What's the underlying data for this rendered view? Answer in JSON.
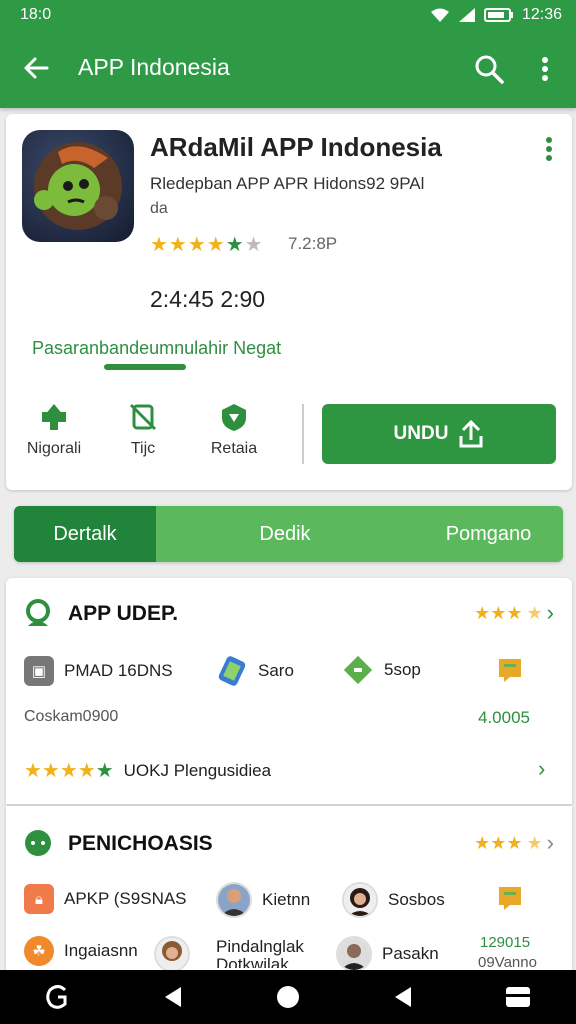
{
  "status_bar": {
    "time_left": "18:0",
    "clock": "12:36"
  },
  "app_bar": {
    "title": "APP Indonesia"
  },
  "app": {
    "name": "ARdaMil APP Indonesia",
    "subtitle": "Rledepban APP APR Hidons92 9PAl",
    "subtitle2": "da",
    "rating_count": "7.2:8P",
    "size": "2:4:45 2:90",
    "link": "Pasaranbandeumnulahir Negat",
    "rating": 3.5
  },
  "actions": [
    {
      "label": "Nigorali",
      "icon": "tree-icon"
    },
    {
      "label": "Tijc",
      "icon": "crossed-device-icon"
    },
    {
      "label": "Retaia",
      "icon": "shield-icon"
    }
  ],
  "download_label": "UNDU",
  "tabs": [
    {
      "label": "Dertalk",
      "active": true
    },
    {
      "label": "Dedik"
    },
    {
      "label": "Pomgano"
    }
  ],
  "section1": {
    "title": "APP UDEP.",
    "items": [
      {
        "label": "PMAD 16DNS",
        "color": "#777777"
      },
      {
        "label": "Saro",
        "color": "#3a7bd5"
      },
      {
        "label": "5sop",
        "color": "#5bb04c"
      }
    ],
    "caption": "Coskam0900",
    "count": "4.0005",
    "review": "UOKJ Plengusidiea"
  },
  "section2": {
    "title": "PENICHOASIS",
    "items": [
      {
        "label": "APKP (S9SNAS",
        "color": "#f07a4a"
      },
      {
        "label": "Kietnn"
      },
      {
        "label": "Sosbos"
      }
    ],
    "row2": [
      {
        "label": "Ingaiasnn",
        "color": "#f08a2a"
      },
      {
        "label": "Pindalnglak Dotkwilak"
      },
      {
        "label": "Pasakn"
      }
    ],
    "num1": "129015",
    "num2": "09Vanno"
  },
  "colors": {
    "primary": "#2f9a46",
    "accent": "#2e8f3f",
    "star": "#f0b21a"
  }
}
